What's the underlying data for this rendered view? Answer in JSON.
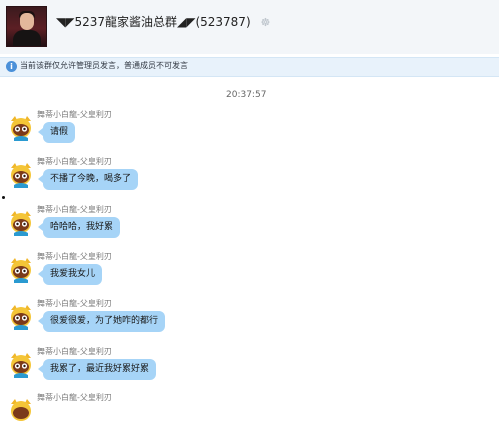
{
  "header": {
    "group_title": "◥◤5237龍家酱油总群◢◤(523787)",
    "title_icon": "qq-group-icon"
  },
  "notice": {
    "text": "当前该群仅允许管理员发言，普通成员不可发言",
    "icon": "info-icon"
  },
  "timestamp": "20:37:57",
  "messages": [
    {
      "sender": "舞蒂小白龍-父皇利刃",
      "text": "请假"
    },
    {
      "sender": "舞蒂小白龍-父皇利刃",
      "text": "不播了今晚，喝多了"
    },
    {
      "sender": "舞蒂小白龍-父皇利刃",
      "text": "哈哈哈，我好累"
    },
    {
      "sender": "舞蒂小白龍-父皇利刃",
      "text": "我爱我女儿"
    },
    {
      "sender": "舞蒂小白龍-父皇利刃",
      "text": "很爱很爱，为了她咋的都行"
    },
    {
      "sender": "舞蒂小白龍-父皇利刃",
      "text": "我累了，最近我好累好累"
    },
    {
      "sender": "舞蒂小白龍-父皇利刃",
      "text": ""
    }
  ],
  "colors": {
    "bubble": "#a6d4f7",
    "notice_bg": "#e8f2fb",
    "info_icon": "#4a90d9"
  }
}
